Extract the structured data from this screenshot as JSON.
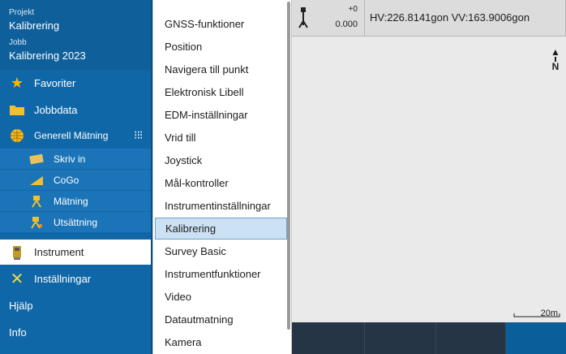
{
  "project": {
    "project_label": "Projekt",
    "project_name": "Kalibrering",
    "job_label": "Jobb",
    "job_name": "Kalibrering 2023"
  },
  "sidebar": {
    "items": [
      {
        "label": "Favoriter",
        "icon": "star-icon"
      },
      {
        "label": "Jobbdata",
        "icon": "folder-icon"
      },
      {
        "label": "Generell Mätning",
        "icon": "globe-icon"
      },
      {
        "label": "Skriv in",
        "icon": "keyin-icon"
      },
      {
        "label": "CoGo",
        "icon": "cogo-icon"
      },
      {
        "label": "Mätning",
        "icon": "measure-icon"
      },
      {
        "label": "Utsättning",
        "icon": "stakeout-icon"
      },
      {
        "label": "Instrument",
        "icon": "instrument-icon",
        "selected": true
      },
      {
        "label": "Inställningar",
        "icon": "settings-icon"
      },
      {
        "label": "Hjälp"
      },
      {
        "label": "Info"
      }
    ],
    "grid_icon": "app-grid-icon"
  },
  "menu": {
    "items": [
      "GNSS-funktioner",
      "Position",
      "Navigera till punkt",
      "Elektronisk Libell",
      "EDM-inställningar",
      "Vrid till",
      "Joystick",
      "Mål-kontroller",
      "Instrumentinställningar",
      "Kalibrering",
      "Survey Basic",
      "Instrumentfunktioner",
      "Video",
      "Datautmatning",
      "Kamera"
    ],
    "selected_index": 9
  },
  "status": {
    "offset_top": "+0",
    "offset_bottom": "0.000",
    "angles": "HV:226.8141gon  VV:163.9006gon"
  },
  "map": {
    "north_label": "N",
    "scale_label": "20m"
  },
  "colors": {
    "sidebar": "#0f67a8",
    "accent": "#0a5e9a",
    "menu_selected": "#cce1f3"
  }
}
